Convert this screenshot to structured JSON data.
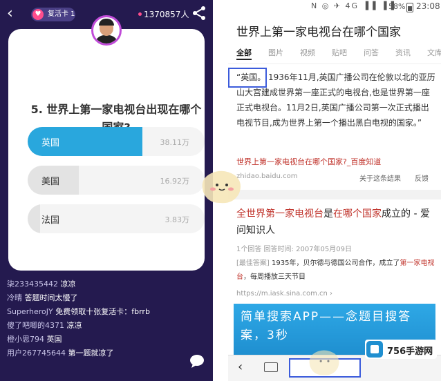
{
  "left": {
    "revive_card": "复活卡 1",
    "viewer_count": "1370857人",
    "question": "5. 世界上第一家电视台出现在哪个国家?",
    "options": [
      {
        "label": "英国",
        "value": "38.11万",
        "fraction": 0.65,
        "correct": true
      },
      {
        "label": "美国",
        "value": "16.92万",
        "fraction": 0.29,
        "correct": false
      },
      {
        "label": "法国",
        "value": "3.83万",
        "fraction": 0.07,
        "correct": false
      }
    ],
    "chat": [
      {
        "user": "柒233435442",
        "text": "凉凉"
      },
      {
        "user": "冷晴",
        "text": "答题时间太慢了"
      },
      {
        "user": "SuperheroJY",
        "text": "免费领取十张复活卡：fbrrb"
      },
      {
        "user": "傻了吧唧的4371",
        "text": "凉凉"
      },
      {
        "user": "橙小思794",
        "text": "英国"
      },
      {
        "user": "用户267745644",
        "text": "第一题就凉了"
      }
    ]
  },
  "right": {
    "status": {
      "battery": "58%",
      "time": "23:08",
      "network": "4G"
    },
    "search_title": "世界上第一家电视台在哪个国家",
    "tabs": [
      "全部",
      "图片",
      "视频",
      "贴吧",
      "问答",
      "资讯",
      "文库"
    ],
    "answer_text": "“英国。 1936年11月,英国广播公司在伦敦以北的亚历山大宫建成世界第一座正式的电视台,也是世界第一座正式电视台。11月2日,英国广播公司第一次正式播出电视节目,成为世界上第一个播出黑白电视的国家。”",
    "source_link": "世界上第一家电视台在哪个国家?_百度知道",
    "source_domain": "zhidao.baidu.com",
    "about_result": "关于这条结果",
    "feedback": "反馈",
    "result2_title_pre": "全世界第一家电视台",
    "result2_title_mid1": "是",
    "result2_title_em": "在哪个国家",
    "result2_title_post": "成立的 - 爱问知识人",
    "result2_meta": "1个回答   回答时间: 2007年05月09日",
    "result2_tag": "[最佳答案]",
    "result2_snippet": " 1935年，贝尔德与德国公司合作，成立了",
    "result2_em": "第一家电视台",
    "result2_snippet_end": "，每周播放三天节目",
    "result2_url": "https://m.iask.sina.com.cn ›",
    "banner_text": "简单搜索APP——念题目搜答案，3秒"
  },
  "watermark": {
    "site": "756手游网"
  },
  "colors": {
    "left_bg": "#241a4f",
    "correct_fill": "#29a7dd",
    "highlight": "#3b5bdb",
    "link_red": "#c0332b"
  }
}
